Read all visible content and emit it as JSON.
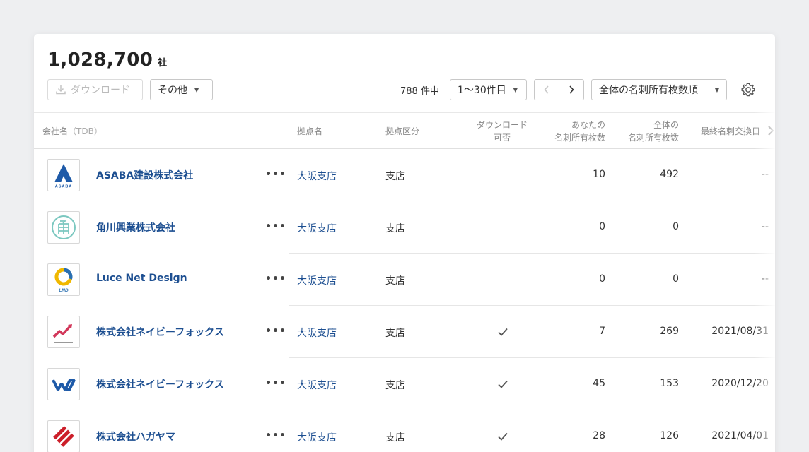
{
  "header": {
    "company_count": "1,028,700",
    "company_unit": "社"
  },
  "toolbar": {
    "download_label": "ダウンロード",
    "other_label": "その他",
    "total_text": "788 件中",
    "range_label": "1〜30件目",
    "sort_label": "全体の名刺所有枚数順"
  },
  "table": {
    "headers": {
      "company": "会社名",
      "company_sub": "（TDB）",
      "branch": "拠点名",
      "branch_type": "拠点区分",
      "download_line1": "ダウンロード",
      "download_line2": "可否",
      "mine_line1": "あなたの",
      "mine_line2": "名刺所有枚数",
      "all_line1": "全体の",
      "all_line2": "名刺所有枚数",
      "last_exchange": "最終名刺交換日"
    },
    "rows": [
      {
        "name": "ASABA建設株式会社",
        "more": "•••",
        "branch": "大阪支店",
        "type": "支店",
        "downloadable": false,
        "mine": "10",
        "all": "492",
        "date": "--"
      },
      {
        "name": "角川興業株式会社",
        "more": "•••",
        "branch": "大阪支店",
        "type": "支店",
        "downloadable": false,
        "mine": "0",
        "all": "0",
        "date": "--"
      },
      {
        "name": "Luce Net Design",
        "more": "•••",
        "branch": "大阪支店",
        "type": "支店",
        "downloadable": false,
        "mine": "0",
        "all": "0",
        "date": "--"
      },
      {
        "name": "株式会社ネイビーフォックス",
        "more": "•••",
        "branch": "大阪支店",
        "type": "支店",
        "downloadable": true,
        "mine": "7",
        "all": "269",
        "date": "2021/08/31"
      },
      {
        "name": "株式会社ネイビーフォックス",
        "more": "•••",
        "branch": "大阪支店",
        "type": "支店",
        "downloadable": true,
        "mine": "45",
        "all": "153",
        "date": "2020/12/20"
      },
      {
        "name": "株式会社ハガヤマ",
        "more": "•••",
        "branch": "大阪支店",
        "type": "支店",
        "downloadable": true,
        "mine": "28",
        "all": "126",
        "date": "2021/04/01"
      }
    ]
  },
  "logos": {
    "row0_text": "ASABA",
    "row2_text": "LND"
  },
  "colors": {
    "link": "#1d4f91",
    "asaba_blue": "#1e5aa8",
    "kadokawa_teal": "#7cc8c0",
    "lnd_yellow": "#f0b800",
    "lnd_blue": "#2a6fb0",
    "navyfox_red": "#d2375a",
    "hagayama_red": "#cc1f2a"
  }
}
